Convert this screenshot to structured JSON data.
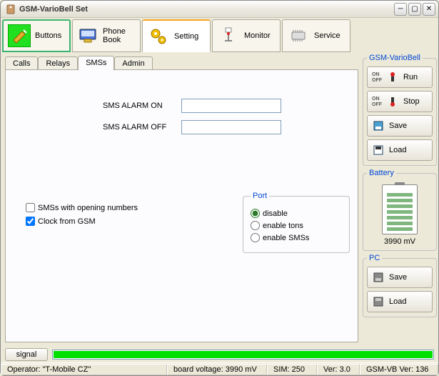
{
  "window": {
    "title": "GSM-VarioBell Set"
  },
  "toolbar": {
    "buttons": "Buttons",
    "phonebook": "Phone Book",
    "setting": "Setting",
    "monitor": "Monitor",
    "service": "Service"
  },
  "subtabs": {
    "calls": "Calls",
    "relays": "Relays",
    "smss": "SMSs",
    "admin": "Admin"
  },
  "form": {
    "alarm_on_label": "SMS ALARM ON",
    "alarm_on_value": "",
    "alarm_off_label": "SMS ALARM OFF",
    "alarm_off_value": "",
    "chk_open_label": "SMSs with opening numbers",
    "chk_open_checked": false,
    "chk_clock_label": "Clock from GSM",
    "chk_clock_checked": true,
    "port_legend": "Port",
    "port_disable": "disable",
    "port_enable_tons": "enable tons",
    "port_enable_smss": "enable SMSs",
    "port_selected": "disable"
  },
  "side": {
    "group1_legend": "GSM-VarioBell",
    "run": "Run",
    "stop": "Stop",
    "save": "Save",
    "load": "Load",
    "battery_legend": "Battery",
    "battery_value": "3990 mV",
    "pc_legend": "PC",
    "pc_save": "Save",
    "pc_load": "Load"
  },
  "signal": {
    "button": "signal"
  },
  "status": {
    "operator": "Operator: \"T-Mobile CZ\"",
    "board": "board voltage: 3990 mV",
    "sim": "SIM: 250",
    "ver": "Ver: 3.0",
    "fw": "GSM-VB Ver: 136"
  }
}
